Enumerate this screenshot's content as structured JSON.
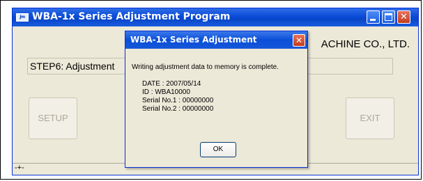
{
  "window": {
    "title": "WBA-1x Series Adjustment Program",
    "icon_label": "Jm",
    "close_glyph": "✕",
    "titlebar_color": "#0a4ad8"
  },
  "main": {
    "company": "ACHINE CO., LTD.",
    "step_text": "STEP6: Adjustment",
    "setup_label": "SETUP",
    "exit_label": "EXIT",
    "status_text": "-+-"
  },
  "dialog": {
    "title": "WBA-1x Series Adjustment",
    "close_glyph": "✕",
    "message": "Writing adjustment data to memory is complete.",
    "info": {
      "date": "DATE : 2007/05/14",
      "id": "ID : WBA10000",
      "serial1": "Serial No.1 : 00000000",
      "serial2": "Serial No.2 : 00000000"
    },
    "ok_label": "OK"
  }
}
